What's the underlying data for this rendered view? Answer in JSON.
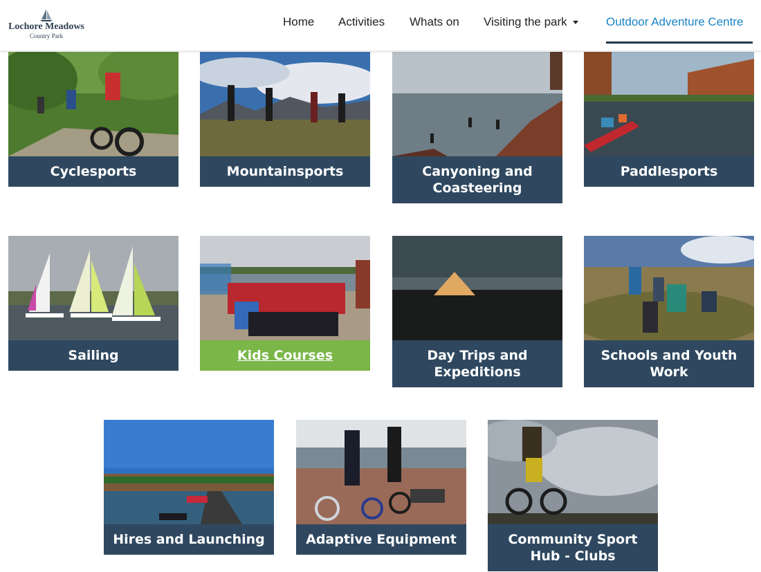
{
  "brand": {
    "title": "Lochore Meadows",
    "subtitle": "Country Park"
  },
  "nav": {
    "home": "Home",
    "activities": "Activities",
    "whats_on": "Whats on",
    "visiting": "Visiting the park",
    "outdoor": "Outdoor Adventure Centre"
  },
  "cards": [
    {
      "label": "Cyclesports"
    },
    {
      "label": "Mountainsports"
    },
    {
      "label": "Canyoning and Coasteering"
    },
    {
      "label": "Paddlesports"
    },
    {
      "label": "Sailing"
    },
    {
      "label": "Kids Courses"
    },
    {
      "label": "Day Trips and Expeditions"
    },
    {
      "label": "Schools and Youth Work"
    },
    {
      "label": "Hires and Launching"
    },
    {
      "label": "Adaptive Equipment"
    },
    {
      "label": "Community Sport Hub - Clubs"
    }
  ],
  "colors": {
    "card_label_bg": "#2f4860",
    "highlight_label_bg": "#7ab648",
    "active_nav": "#1b83c4"
  }
}
